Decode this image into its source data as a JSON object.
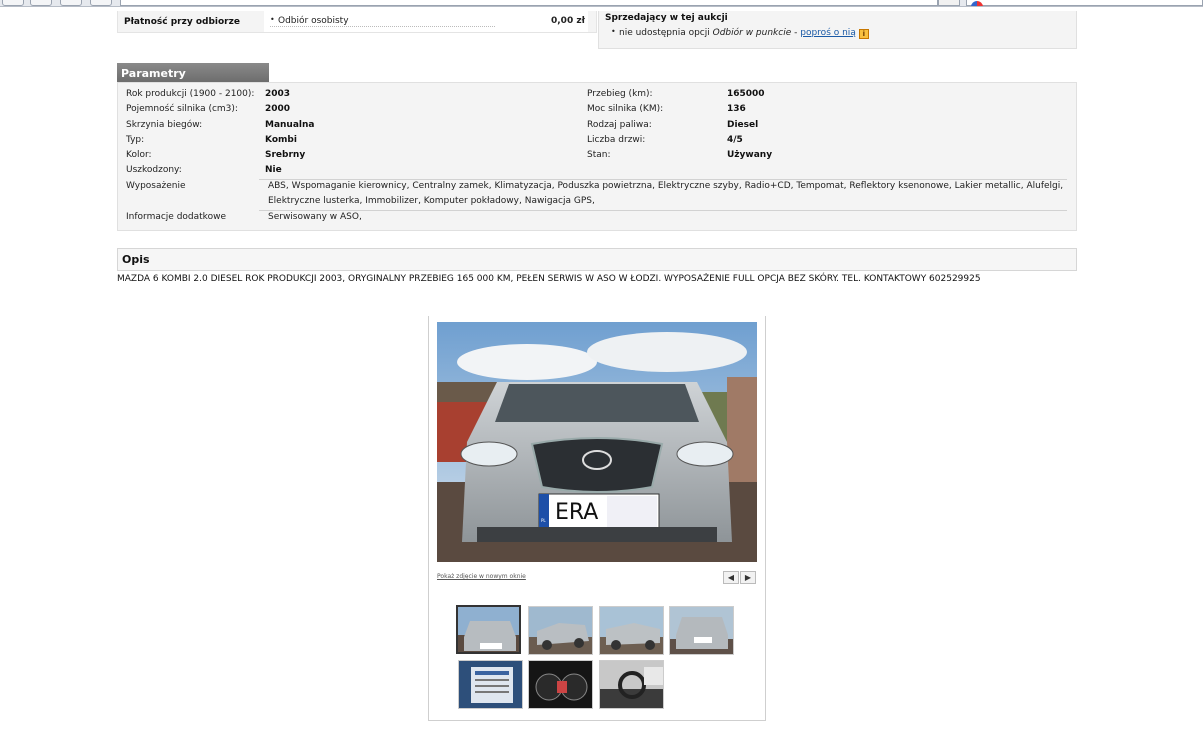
{
  "payment": {
    "label": "Płatność przy odbiorze",
    "option": "Odbiór osobisty",
    "price": "0,00 zł"
  },
  "seller": {
    "title": "Sprzedający w tej aukcji",
    "text_prefix": "nie udostępnia opcji",
    "option_em": "Odbiór w punkcie",
    "sep": "-",
    "link": "poproś o nią",
    "info_icon": "i"
  },
  "parametry": {
    "header": "Parametry",
    "left": [
      {
        "label": "Rok produkcji (1900 - 2100):",
        "value": "2003"
      },
      {
        "label": "Pojemność silnika (cm3):",
        "value": "2000"
      },
      {
        "label": "Skrzynia biegów:",
        "value": "Manualna"
      },
      {
        "label": "Typ:",
        "value": "Kombi"
      },
      {
        "label": "Kolor:",
        "value": "Srebrny"
      },
      {
        "label": "Uszkodzony:",
        "value": "Nie"
      }
    ],
    "right": [
      {
        "label": "Przebieg (km):",
        "value": "165000"
      },
      {
        "label": "Moc silnika (KM):",
        "value": "136"
      },
      {
        "label": "Rodzaj paliwa:",
        "value": "Diesel"
      },
      {
        "label": "Liczba drzwi:",
        "value": "4/5"
      },
      {
        "label": "Stan:",
        "value": "Używany"
      }
    ],
    "wyposazenie_label": "Wyposażenie",
    "wyposazenie_value": "ABS, Wspomaganie kierownicy, Centralny zamek, Klimatyzacja, Poduszka powietrzna, Elektryczne szyby, Radio+CD, Tempomat, Reflektory ksenonowe, Lakier metallic, Alufelgi, Elektryczne lusterka, Immobilizer, Komputer pokładowy, Nawigacja GPS,",
    "info_label": "Informacje dodatkowe",
    "info_value": "Serwisowany w ASO,"
  },
  "opis": {
    "header": "Opis",
    "text": "MAZDA 6 KOMBI 2.0 DIESEL ROK PRODUKCJI 2003, ORYGINALNY PRZEBIEG 165 000 KM, PEŁEN SERWIS W ASO W ŁODZI. WYPOSAŻENIE FULL OPCJA BEZ SKÓRY. TEL. KONTAKTOWY 602529925"
  },
  "gallery": {
    "show_new_window": "Pokaż zdjęcie w nowym oknie",
    "prev": "◀",
    "next": "▶",
    "plate_text": "ERA",
    "plate_country": "PL"
  },
  "colors": {
    "header_gray": "#7a7a7a",
    "link_blue": "#1b5aa6",
    "car_silver": "#b8bdc1"
  }
}
